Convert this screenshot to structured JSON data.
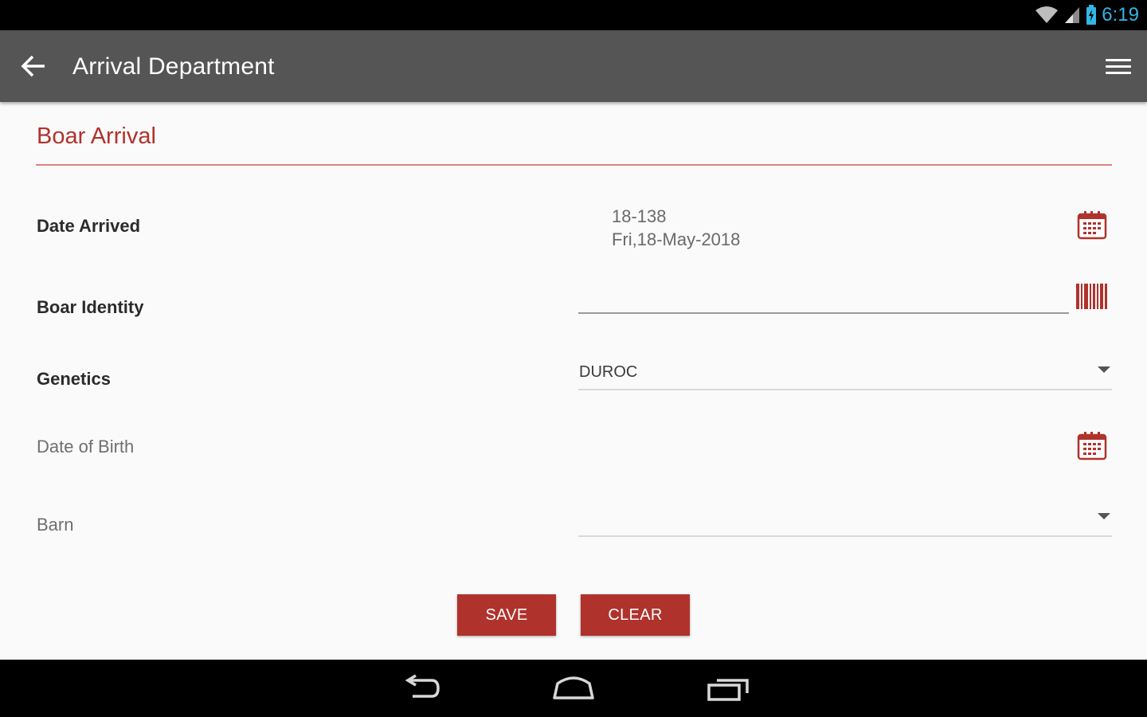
{
  "status_bar": {
    "time": "6:19",
    "icons": [
      "wifi-icon",
      "cell-signal-icon",
      "battery-charging-icon"
    ]
  },
  "app_bar": {
    "title": "Arrival Department",
    "back_icon": "arrow-back-icon",
    "menu_icon": "hamburger-menu-icon"
  },
  "form": {
    "section_title": "Boar Arrival",
    "fields": {
      "date_arrived": {
        "label": "Date Arrived",
        "value_line1": "18-138",
        "value_line2": "Fri,18-May-2018",
        "icon": "calendar-icon"
      },
      "boar_identity": {
        "label": "Boar Identity",
        "value": "",
        "icon": "barcode-icon"
      },
      "genetics": {
        "label": "Genetics",
        "selected": "DUROC"
      },
      "date_of_birth": {
        "label": "Date of Birth",
        "icon": "calendar-icon"
      },
      "barn": {
        "label": "Barn",
        "selected": ""
      }
    },
    "buttons": {
      "save_label": "SAVE",
      "clear_label": "CLEAR"
    }
  },
  "nav_bar": {
    "icons": [
      "back-nav-icon",
      "home-nav-icon",
      "recents-nav-icon"
    ]
  },
  "colors": {
    "accent": "#b0322c",
    "app_bar": "#555555",
    "status_time": "#33b5e5",
    "background": "#fafafa"
  }
}
